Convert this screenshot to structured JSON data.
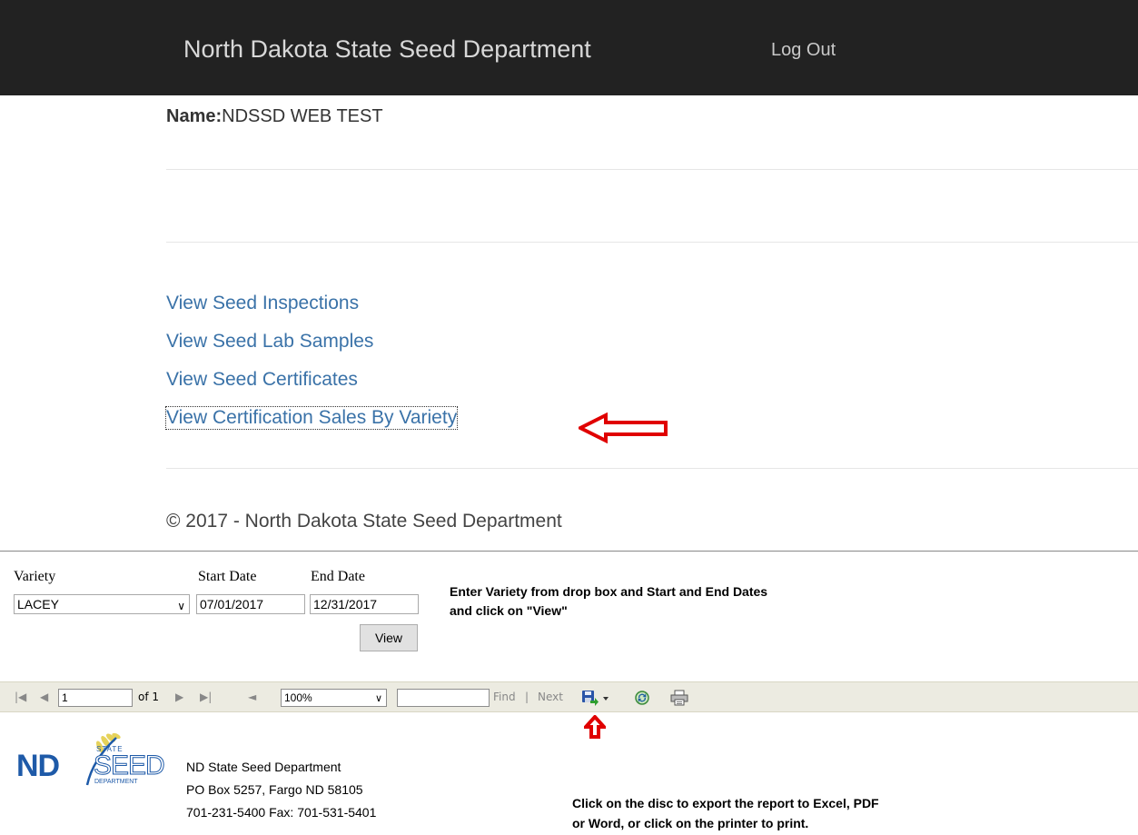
{
  "header": {
    "brand": "North Dakota State Seed Department",
    "logout": "Log Out"
  },
  "user": {
    "name_label": "Name:",
    "name_value": "NDSSD WEB TEST"
  },
  "nav_links": [
    "View Seed Inspections",
    "View Seed Lab Samples",
    "View Seed Certificates",
    "View Certification Sales By Variety"
  ],
  "footer": {
    "copyright": "© 2017 - North Dakota State Seed Department"
  },
  "report_params": {
    "variety_label": "Variety",
    "variety_value": "LACEY",
    "start_label": "Start Date",
    "start_value": "07/01/2017",
    "end_label": "End Date",
    "end_value": "12/31/2017",
    "view_button": "View"
  },
  "instructions": {
    "line1": "Enter Variety from drop box and Start and End Dates",
    "line2": "and click on \"View\"",
    "export_line1": "Click on the disc to export the report to Excel, PDF",
    "export_line2": "or Word, or click on the printer to print."
  },
  "toolbar": {
    "page_value": "1",
    "of_pages": "of 1",
    "zoom": "100%",
    "find_value": "",
    "find_label": "Find",
    "separator": "|",
    "next_label": "Next"
  },
  "report": {
    "logo_nd": "ND",
    "logo_state": "STATE",
    "logo_seed": "SEED",
    "logo_department": "DEPARTMENT",
    "org_name": "ND State Seed Department",
    "address": "PO Box 5257, Fargo ND 58105",
    "phone": "701-231-5400 Fax: 701-531-5401"
  },
  "colors": {
    "header_bg": "#222222",
    "link": "#3a72a8",
    "annotation_arrow": "#e00000",
    "toolbar_bg": "#ecebe1",
    "logo_blue": "#1e5aa8"
  }
}
